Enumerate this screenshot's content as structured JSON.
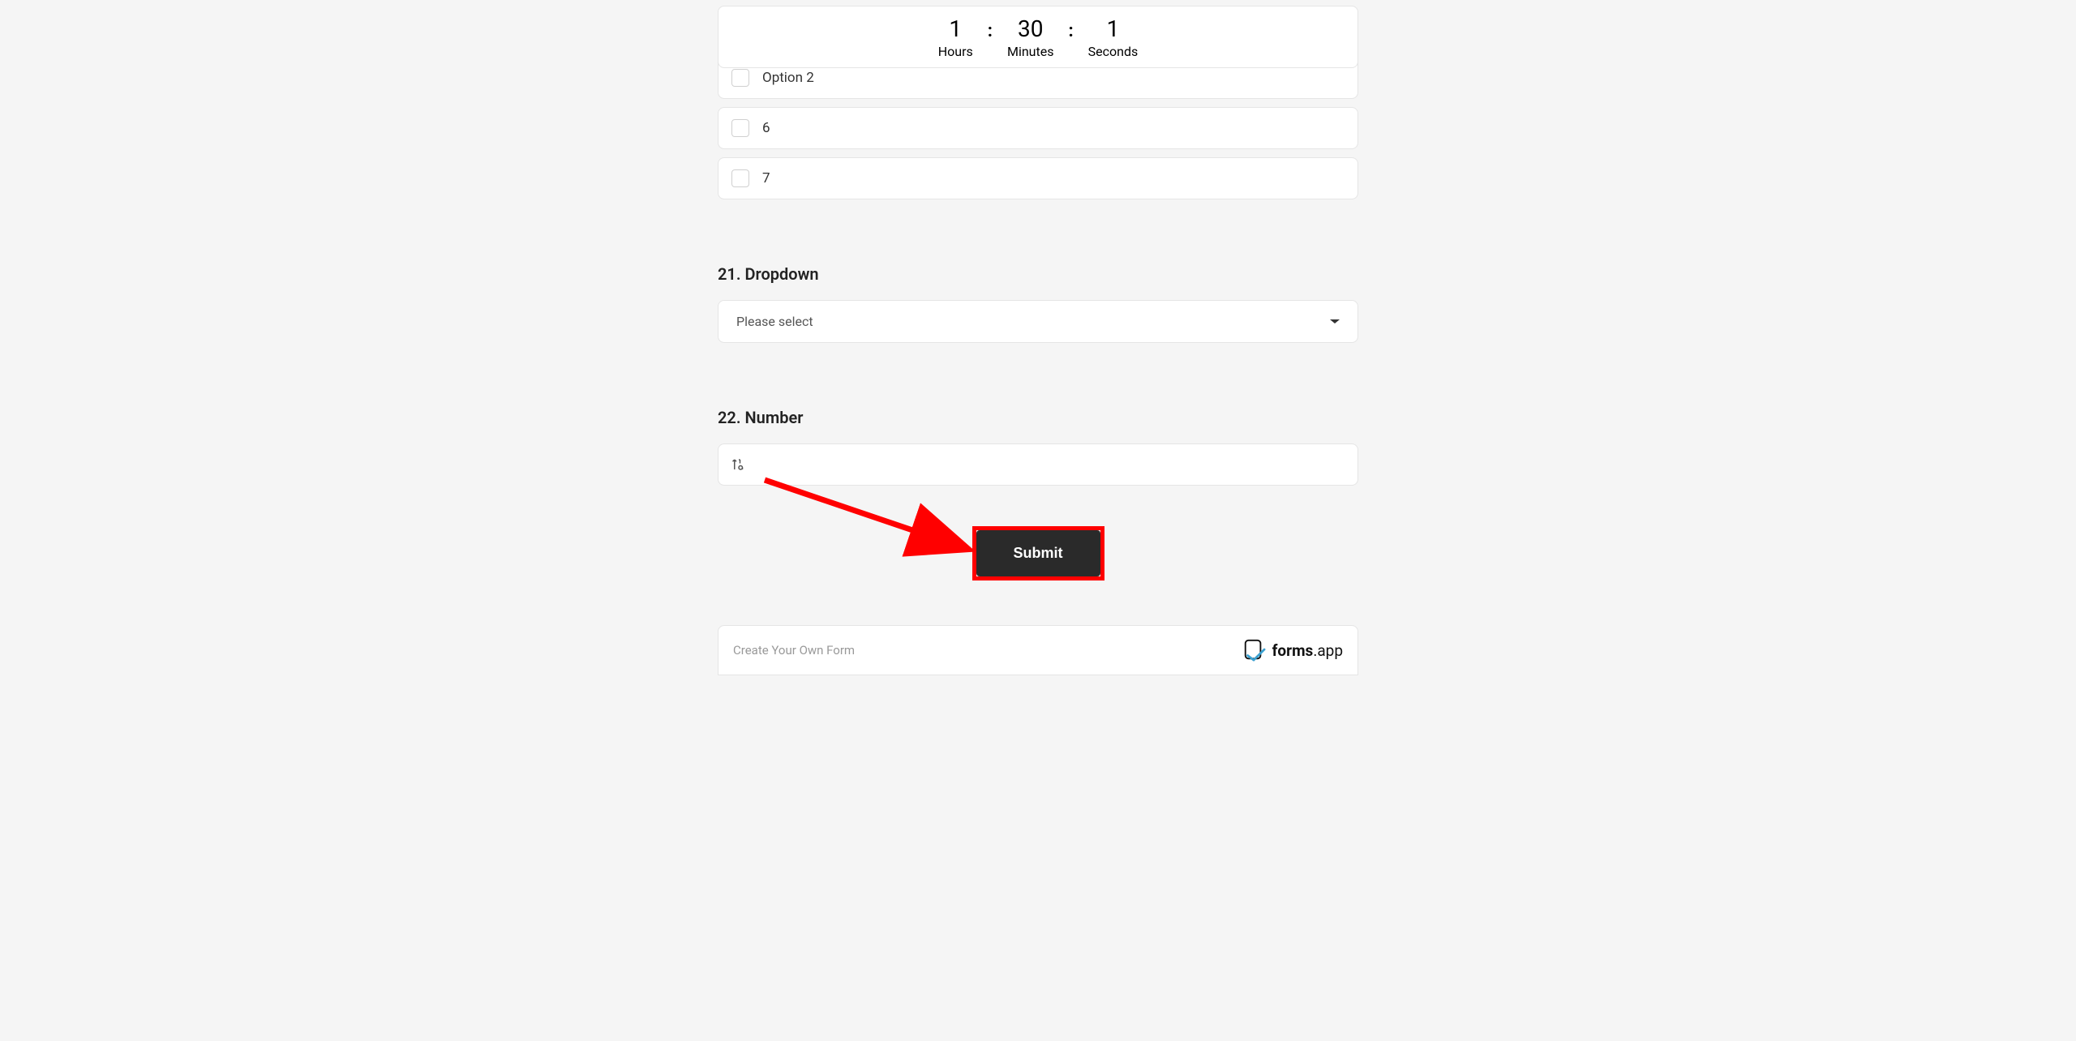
{
  "timer": {
    "hours": {
      "value": "1",
      "label": "Hours"
    },
    "minutes": {
      "value": "30",
      "label": "Minutes"
    },
    "seconds": {
      "value": "1",
      "label": "Seconds"
    }
  },
  "options": {
    "clipped": "Option 2",
    "opt1": "6",
    "opt2": "7"
  },
  "questions": {
    "q21": {
      "title": "21. Dropdown",
      "placeholder": "Please select"
    },
    "q22": {
      "title": "22. Number"
    }
  },
  "submit": {
    "label": "Submit"
  },
  "footer": {
    "cta": "Create Your Own Form",
    "brand_main": "forms",
    "brand_suffix": ".app"
  }
}
